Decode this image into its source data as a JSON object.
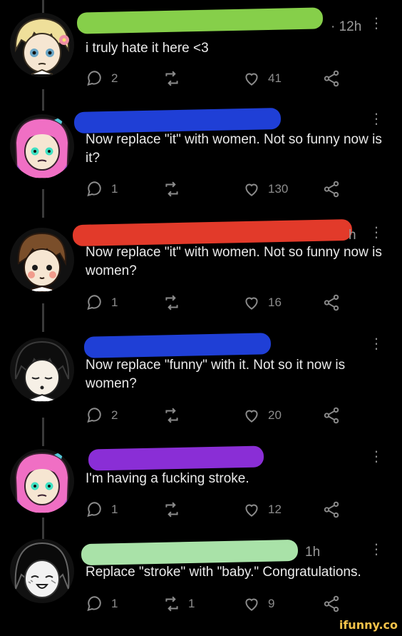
{
  "posts": [
    {
      "time": "· 12h",
      "text": "i truly hate it here <3",
      "replies": "2",
      "reposts": "",
      "likes": "41",
      "scribble_color": "#86cf4a",
      "avatar": "blonde-character"
    },
    {
      "time": "",
      "text": "Now replace \"it\" with women. Not so funny now is it?",
      "replies": "1",
      "reposts": "",
      "likes": "130",
      "scribble_color": "#1f3fd6",
      "avatar": "pink-hair-character"
    },
    {
      "time": "h",
      "text": "Now replace \"it\" with women. Not so funny now is women?",
      "replies": "1",
      "reposts": "",
      "likes": "16",
      "scribble_color": "#e23a2a",
      "avatar": "brown-hair-character"
    },
    {
      "time": "",
      "text": "Now replace \"funny\" with it. Not so it now is women?",
      "replies": "2",
      "reposts": "",
      "likes": "20",
      "scribble_color": "#1f3fd6",
      "avatar": "black-hair-character"
    },
    {
      "time": "",
      "text": "I'm having a fucking stroke.",
      "replies": "1",
      "reposts": "",
      "likes": "12",
      "scribble_color": "#8a2ed6",
      "avatar": "pink-hair-character"
    },
    {
      "time": "1h",
      "text": "Replace \"stroke\" with \"baby.\" Congratulations.",
      "replies": "1",
      "reposts": "1",
      "likes": "9",
      "scribble_color": "#a9e2a8",
      "avatar": "monochrome-character"
    }
  ],
  "footer": {
    "watermark": "ifunny.co"
  },
  "icons": {
    "reply": "comment-icon",
    "repost": "repost-icon",
    "like": "heart-icon",
    "share": "share-icon",
    "more": "more-vertical-icon"
  }
}
